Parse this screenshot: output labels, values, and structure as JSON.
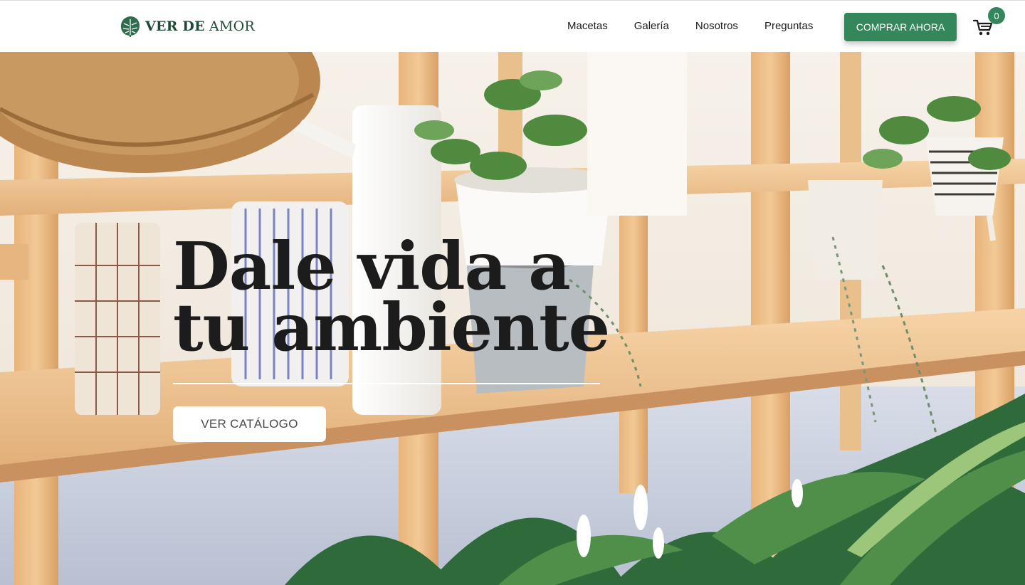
{
  "brand": {
    "name_strong": "VER DE",
    "name_light": "AMOR",
    "logo_icon": "monstera-leaf-icon",
    "color": "#1f4a33"
  },
  "nav": {
    "items": [
      {
        "label": "Macetas"
      },
      {
        "label": "Galería"
      },
      {
        "label": "Nosotros"
      },
      {
        "label": "Preguntas"
      }
    ]
  },
  "header": {
    "cta_label": "COMPRAR AHORA",
    "cta_color": "#34875a",
    "cart_icon": "shopping-cart-icon",
    "cart_count": "0"
  },
  "hero": {
    "title_line1": "Dale vida a",
    "title_line2": "tu ambiente",
    "button_label": "VER CATÁLOGO"
  }
}
